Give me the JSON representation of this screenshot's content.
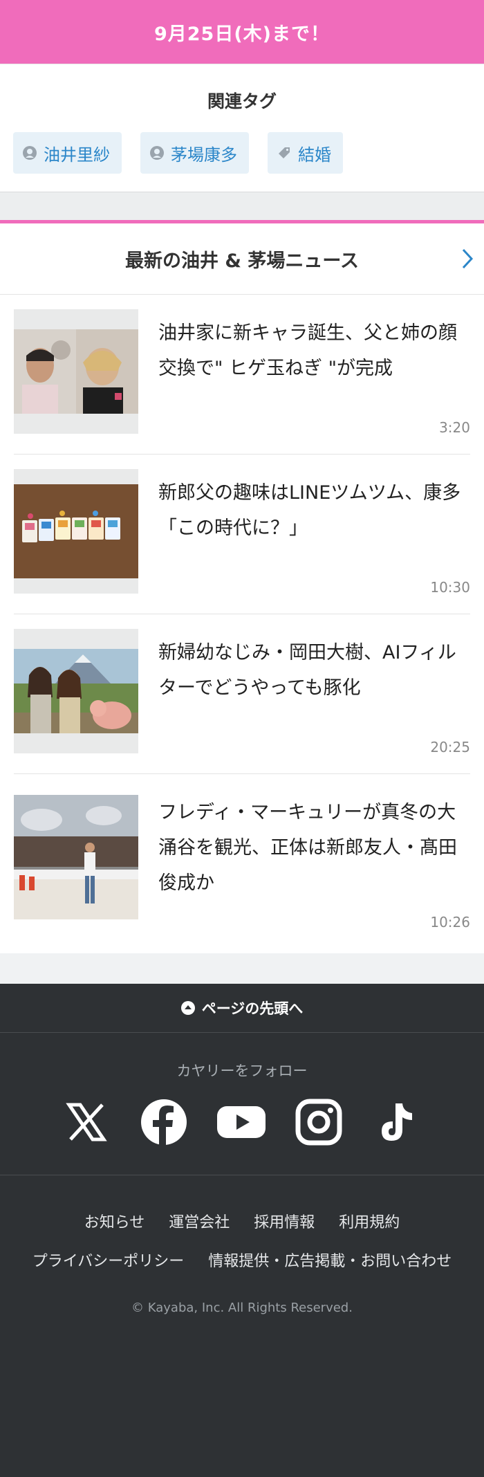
{
  "banner": {
    "text": "9月25日(木)まで！"
  },
  "related_tags": {
    "heading": "関連タグ",
    "items": [
      {
        "label": "油井里紗",
        "icon": "person-icon"
      },
      {
        "label": "茅場康多",
        "icon": "person-icon"
      },
      {
        "label": "結婚",
        "icon": "tag-icon"
      }
    ]
  },
  "news": {
    "heading": "最新の油井 & 茅場ニュース",
    "items": [
      {
        "title": "油井家に新キャラ誕生、父と姉の顔交換で\" ヒゲ玉ねぎ \"が完成",
        "time": "3:20"
      },
      {
        "title": "新郎父の趣味はLINEツムツム、康多「この時代に？」",
        "time": "10:30"
      },
      {
        "title": "新婦幼なじみ・岡田大樹、AIフィルターでどうやっても豚化",
        "time": "20:25"
      },
      {
        "title": "フレディ・マーキュリーが真冬の大涌谷を観光、正体は新郎友人・髙田俊成か",
        "time": "10:26"
      }
    ]
  },
  "footer": {
    "to_top": "ページの先頭へ",
    "follow": "カヤリーをフォロー",
    "social": [
      "x-icon",
      "facebook-icon",
      "youtube-icon",
      "instagram-icon",
      "tiktok-icon"
    ],
    "links_row1": [
      "お知らせ",
      "運営会社",
      "採用情報",
      "利用規約"
    ],
    "links_row2": [
      "プライバシーポリシー",
      "情報提供・広告掲載・お問い合わせ"
    ],
    "copyright": "© Kayaba, Inc. All Rights Reserved."
  },
  "colors": {
    "accent_pink": "#f06cbb",
    "link_blue": "#2b86c9",
    "footer_bg": "#2e3134"
  }
}
